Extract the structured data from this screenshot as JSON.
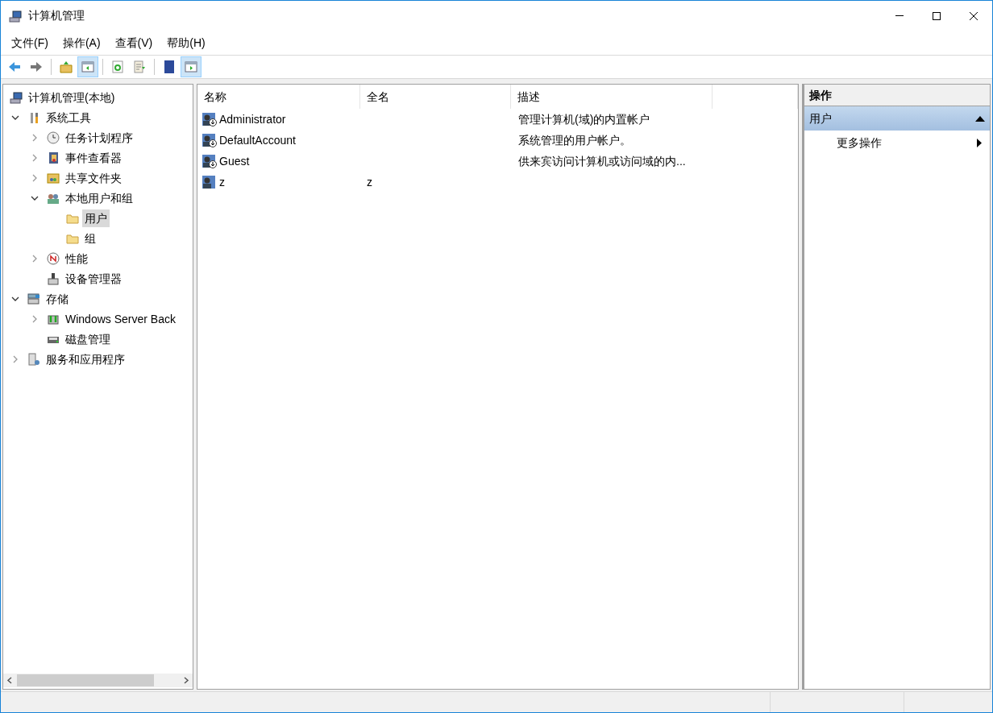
{
  "window": {
    "title": "计算机管理"
  },
  "menu": [
    "文件(F)",
    "操作(A)",
    "查看(V)",
    "帮助(H)"
  ],
  "toolbar": [
    {
      "kind": "back",
      "pressed": false
    },
    {
      "kind": "forward",
      "pressed": false
    },
    {
      "kind": "sep"
    },
    {
      "kind": "up",
      "pressed": false
    },
    {
      "kind": "tree-toggle",
      "pressed": true
    },
    {
      "kind": "sep"
    },
    {
      "kind": "refresh",
      "pressed": false
    },
    {
      "kind": "export",
      "pressed": false
    },
    {
      "kind": "sep"
    },
    {
      "kind": "help",
      "pressed": false
    },
    {
      "kind": "action-toggle",
      "pressed": true
    }
  ],
  "tree": [
    {
      "label": "计算机管理(本地)",
      "kind": "computer",
      "selected": false,
      "children": [
        {
          "label": "系统工具",
          "kind": "tools",
          "expanded": true,
          "selected": false,
          "children": [
            {
              "label": "任务计划程序",
              "kind": "clock",
              "expanded": false,
              "selected": false
            },
            {
              "label": "事件查看器",
              "kind": "log",
              "expanded": false,
              "selected": false
            },
            {
              "label": "共享文件夹",
              "kind": "share",
              "expanded": false,
              "selected": false
            },
            {
              "label": "本地用户和组",
              "kind": "users",
              "expanded": true,
              "selected": false,
              "children": [
                {
                  "label": "用户",
                  "kind": "folder",
                  "selected": true
                },
                {
                  "label": "组",
                  "kind": "folder",
                  "selected": false
                }
              ]
            },
            {
              "label": "性能",
              "kind": "gauge",
              "expanded": false,
              "selected": false
            },
            {
              "label": "设备管理器",
              "kind": "device",
              "selected": false
            }
          ]
        },
        {
          "label": "存储",
          "kind": "storage",
          "expanded": true,
          "selected": false,
          "children": [
            {
              "label": "Windows Server Back",
              "kind": "backup",
              "expanded": false,
              "selected": false
            },
            {
              "label": "磁盘管理",
              "kind": "disk",
              "selected": false
            }
          ]
        },
        {
          "label": "服务和应用程序",
          "kind": "services",
          "expanded": false,
          "selected": false
        }
      ]
    }
  ],
  "table": {
    "columns": [
      "名称",
      "全名",
      "描述"
    ],
    "rows": [
      {
        "name": "Administrator",
        "full_name": "",
        "description": "管理计算机(域)的内置帐户",
        "kind": "disabled-user"
      },
      {
        "name": "DefaultAccount",
        "full_name": "",
        "description": "系统管理的用户帐户。",
        "kind": "disabled-user"
      },
      {
        "name": "Guest",
        "full_name": "",
        "description": "供来宾访问计算机或访问域的内...",
        "kind": "disabled-user"
      },
      {
        "name": "z",
        "full_name": "z",
        "description": "",
        "kind": "user"
      }
    ]
  },
  "actions": {
    "title": "操作",
    "sections": [
      {
        "title": "用户",
        "expanded": true,
        "items": [
          "更多操作"
        ]
      }
    ]
  }
}
